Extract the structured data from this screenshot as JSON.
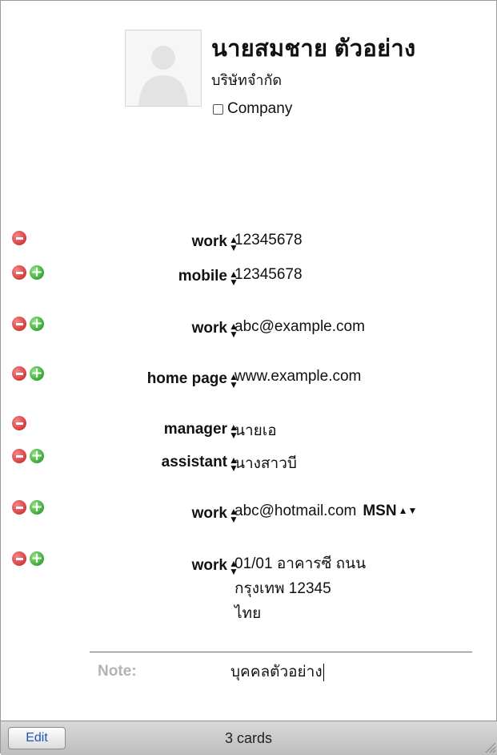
{
  "card": {
    "name": "นายสมชาย ตัวอย่าง",
    "company": "บริษัทจำกัด",
    "company_checkbox_label": "Company"
  },
  "fields": [
    {
      "label": "work",
      "value": "12345678",
      "buttons": [
        "remove"
      ]
    },
    {
      "label": "mobile",
      "value": "12345678",
      "buttons": [
        "remove",
        "add"
      ]
    },
    {
      "label": "work",
      "value": "abc@example.com",
      "buttons": [
        "remove",
        "add"
      ]
    },
    {
      "label": "home page",
      "value": "www.example.com",
      "buttons": [
        "remove",
        "add"
      ]
    },
    {
      "label": "manager",
      "value": "นายเอ",
      "buttons": [
        "remove"
      ]
    },
    {
      "label": "assistant",
      "value": "นางสาวบี",
      "buttons": [
        "remove",
        "add"
      ]
    },
    {
      "label": "work",
      "value": "abc@hotmail.com",
      "service": "MSN",
      "buttons": [
        "remove",
        "add"
      ]
    },
    {
      "label": "work",
      "address_lines": [
        "01/01 อาคารซี ถนน",
        "กรุงเทพ 12345",
        "ไทย"
      ],
      "buttons": [
        "remove",
        "add"
      ]
    }
  ],
  "note": {
    "label": "Note:",
    "value": "บุคคลตัวอย่าง"
  },
  "statusbar": {
    "edit_label": "Edit",
    "count_text": "3 cards"
  },
  "colors": {
    "remove_button": "#d63a3a",
    "add_button": "#33a933",
    "edit_text": "#1d56b5"
  }
}
